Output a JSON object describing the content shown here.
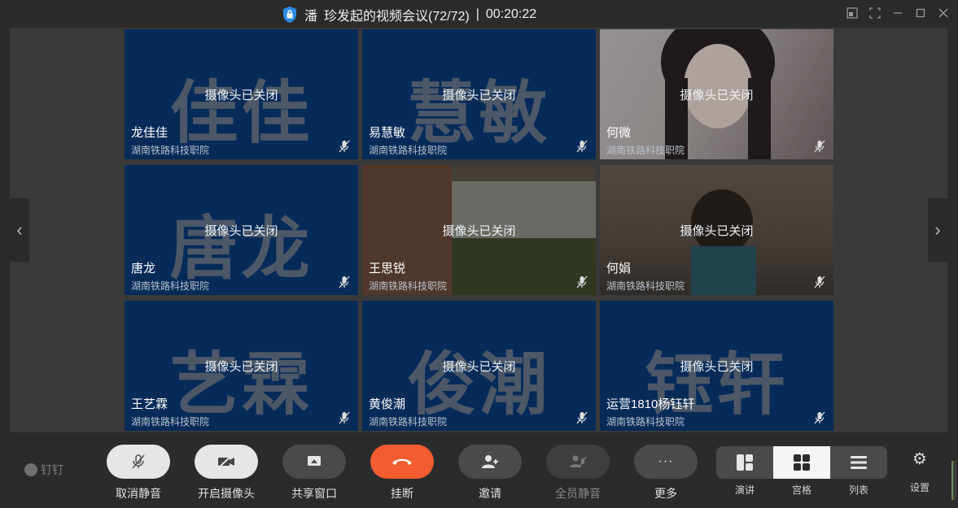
{
  "title": {
    "org_char": "潘",
    "text": "珍发起的视频会议(72/72)",
    "separator": "|",
    "timer": "00:20:22"
  },
  "window_controls": [
    "restore-window-icon",
    "fullscreen-icon",
    "minimize-icon",
    "maximize-icon",
    "close-icon"
  ],
  "tiles": [
    {
      "big": "佳佳",
      "cam": "摄像头已关闭",
      "name": "龙佳佳",
      "org": "湖南铁路科技职院",
      "style": "blue"
    },
    {
      "big": "慧敏",
      "cam": "摄像头已关闭",
      "name": "易慧敏",
      "org": "湖南铁路科技职院",
      "style": "blue"
    },
    {
      "big": "",
      "cam": "摄像头已关闭",
      "name": "何微",
      "org": "湖南铁路科技职院",
      "style": "photo1"
    },
    {
      "big": "唐龙",
      "cam": "摄像头已关闭",
      "name": "唐龙",
      "org": "湖南铁路科技职院",
      "style": "blue"
    },
    {
      "big": "",
      "cam": "摄像头已关闭",
      "name": "王思锐",
      "org": "湖南铁路科技职院",
      "style": "photo2"
    },
    {
      "big": "",
      "cam": "摄像头已关闭",
      "name": "何娟",
      "org": "湖南铁路科技职院",
      "style": "photo3"
    },
    {
      "big": "艺霖",
      "cam": "摄像头已关闭",
      "name": "王艺霖",
      "org": "湖南铁路科技职院",
      "style": "blue"
    },
    {
      "big": "俊潮",
      "cam": "摄像头已关闭",
      "name": "黄俊潮",
      "org": "湖南铁路科技职院",
      "style": "blue"
    },
    {
      "big": "钰轩",
      "cam": "摄像头已关闭",
      "name": "运营1810杨钰轩",
      "org": "湖南铁路科技职院",
      "style": "blue"
    }
  ],
  "brand": "钉钉",
  "toolbar": {
    "unmute": "取消静音",
    "camera_on": "开启摄像头",
    "share_window": "共享窗口",
    "hangup": "挂断",
    "invite": "邀请",
    "mute_all": "全员静音",
    "more": "更多",
    "more_icon": "···"
  },
  "layouts": {
    "speaker": "演讲",
    "grid": "宫格",
    "list": "列表",
    "active": "grid"
  },
  "settings": "设置",
  "colors": {
    "tile_blue": "#062b59",
    "hangup_red": "#f25c30",
    "shield_blue": "#2e8ae6"
  }
}
